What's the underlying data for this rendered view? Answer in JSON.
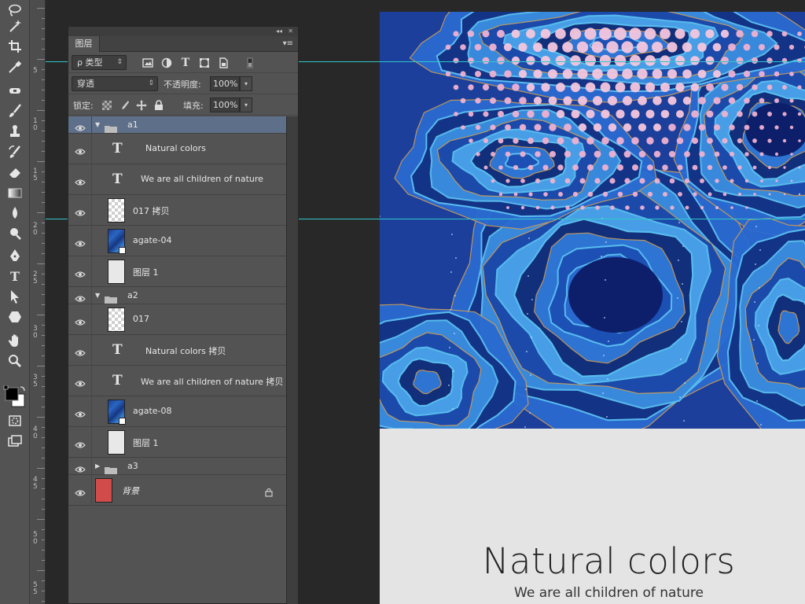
{
  "panel": {
    "tab_label": "图层",
    "collapse_glyph": "◂◂",
    "close_glyph": "✕",
    "menu_glyph": "▾≡"
  },
  "filter": {
    "kind_label": "ρ 类型",
    "icons": [
      "image-filter-icon",
      "adjustment-filter-icon",
      "type-filter-icon",
      "shape-filter-icon",
      "smart-object-filter-icon",
      "filter-toggle-icon"
    ]
  },
  "blend": {
    "mode_value": "穿透",
    "opacity_label": "不透明度:",
    "opacity_value": "100%"
  },
  "lock": {
    "label": "锁定:",
    "fill_label": "填充:",
    "fill_value": "100%"
  },
  "layers": [
    {
      "kind": "group",
      "name": "a1",
      "expanded": true,
      "selected": true
    },
    {
      "kind": "text",
      "name": "Natural colors"
    },
    {
      "kind": "text",
      "name": "We are all children of nature"
    },
    {
      "kind": "raster",
      "thumb": "checker",
      "name": "017 拷贝"
    },
    {
      "kind": "smart",
      "thumb": "agate",
      "name": "agate-04"
    },
    {
      "kind": "raster",
      "thumb": "white",
      "name": "图层 1"
    },
    {
      "kind": "group",
      "name": "a2",
      "expanded": true
    },
    {
      "kind": "raster",
      "thumb": "checker",
      "name": "017"
    },
    {
      "kind": "text",
      "name": "Natural colors 拷贝"
    },
    {
      "kind": "text",
      "name": "We are all children of nature 拷贝"
    },
    {
      "kind": "smart",
      "thumb": "agate",
      "name": "agate-08"
    },
    {
      "kind": "raster",
      "thumb": "white",
      "name": "图层 1"
    },
    {
      "kind": "group",
      "name": "a3",
      "expanded": false
    },
    {
      "kind": "background",
      "thumb": "red",
      "name": "背景",
      "locked": true
    }
  ],
  "ruler": {
    "labels": [
      "5",
      "1\n0",
      "1\n5",
      "2\n0",
      "2\n5",
      "3\n0",
      "3\n5",
      "4\n0",
      "4\n5",
      "5\n0",
      "5\n5"
    ]
  },
  "canvas": {
    "title": "Natural colors",
    "subtitle": "We are all children of nature"
  },
  "colors": {
    "guide": "#30c6c8",
    "selection": "#5d6f89",
    "background_layer_thumb": "#d24b4b",
    "artwork_blue": "#1e46a8",
    "dot_pink": "#f2b7d4"
  },
  "tools": [
    "lasso-tool-icon",
    "magic-wand-tool-icon",
    "crop-tool-icon",
    "eyedropper-tool-icon",
    "healing-brush-tool-icon",
    "brush-tool-icon",
    "clone-stamp-tool-icon",
    "history-brush-tool-icon",
    "eraser-tool-icon",
    "gradient-tool-icon",
    "blur-tool-icon",
    "dodge-tool-icon",
    "pen-tool-icon",
    "type-tool-icon",
    "path-selection-tool-icon",
    "shape-tool-icon",
    "hand-tool-icon",
    "zoom-tool-icon",
    "color-swatches",
    "quick-mask-icon",
    "screen-mode-icon"
  ],
  "type_glyph": "T"
}
